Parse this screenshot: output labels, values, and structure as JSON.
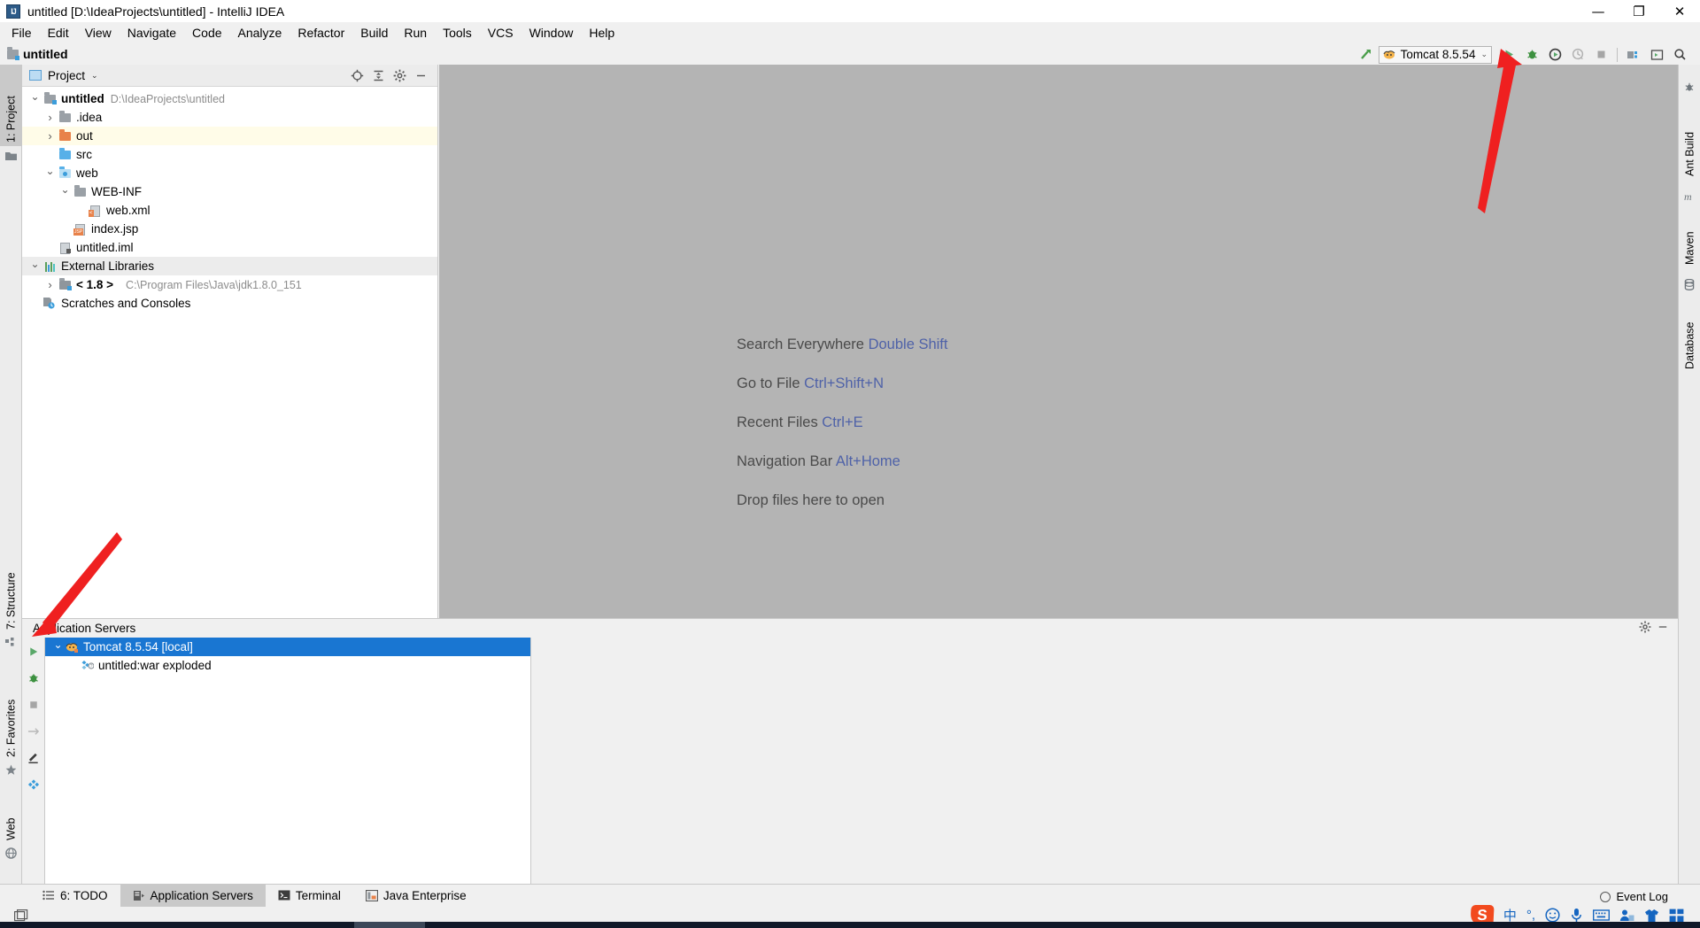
{
  "window": {
    "title": "untitled [D:\\IdeaProjects\\untitled] - IntelliJ IDEA",
    "logo": "IJ",
    "minimize": "—",
    "maximize": "❐",
    "close": "✕"
  },
  "menubar": {
    "items": [
      {
        "label": "File",
        "mnemonic": "F"
      },
      {
        "label": "Edit",
        "mnemonic": "E"
      },
      {
        "label": "View",
        "mnemonic": "V"
      },
      {
        "label": "Navigate",
        "mnemonic": "N"
      },
      {
        "label": "Code",
        "mnemonic": "C"
      },
      {
        "label": "Analyze",
        "mnemonic": "z"
      },
      {
        "label": "Refactor",
        "mnemonic": "R"
      },
      {
        "label": "Build",
        "mnemonic": "B"
      },
      {
        "label": "Run",
        "mnemonic": "n"
      },
      {
        "label": "Tools",
        "mnemonic": "T"
      },
      {
        "label": "VCS",
        "mnemonic": "S"
      },
      {
        "label": "Window",
        "mnemonic": "W"
      },
      {
        "label": "Help",
        "mnemonic": "H"
      }
    ]
  },
  "navbar": {
    "breadcrumb": "untitled"
  },
  "toolbar": {
    "build_hammer": "build-icon",
    "run_config": {
      "name": "Tomcat 8.5.54",
      "chevron": "⌄"
    },
    "buttons": [
      {
        "name": "run-button",
        "glyph": "▶"
      },
      {
        "name": "debug-button",
        "glyph": "bug"
      },
      {
        "name": "run-coverage-button",
        "glyph": "coverage"
      },
      {
        "name": "profile-button",
        "glyph": "profile"
      },
      {
        "name": "stop-button",
        "glyph": "■"
      },
      {
        "name": "project-structure-button",
        "glyph": "structure"
      },
      {
        "name": "hide-windows-button",
        "glyph": "window"
      },
      {
        "name": "search-everywhere-button",
        "glyph": "search"
      }
    ]
  },
  "left_strip": {
    "top": [
      {
        "label": "1: Project",
        "mnemonic": "1",
        "active": true,
        "icon": "project-icon"
      }
    ],
    "bottom": [
      {
        "label": "7: Structure",
        "mnemonic": "7",
        "icon": "structure-icon"
      },
      {
        "label": "2: Favorites",
        "mnemonic": "2",
        "icon": "star-icon"
      },
      {
        "label": "Web",
        "mnemonic": "",
        "icon": "globe-icon"
      }
    ]
  },
  "right_strip": {
    "items": [
      {
        "label": "Ant Build",
        "icon": "ant-icon"
      },
      {
        "label": "Maven",
        "icon": "maven-icon"
      },
      {
        "label": "Database",
        "icon": "database-icon"
      }
    ]
  },
  "project_panel": {
    "title": "Project",
    "chevron": "⌄",
    "actions": [
      {
        "name": "locate-file-button",
        "glyph": "⊕"
      },
      {
        "name": "collapse-all-button",
        "glyph": "⇱"
      },
      {
        "name": "settings-gear-button",
        "glyph": "⚙"
      },
      {
        "name": "hide-panel-button",
        "glyph": "—"
      }
    ],
    "tree": [
      {
        "label": "untitled",
        "path": "D:\\IdeaProjects\\untitled",
        "indent": 0,
        "twisty": "open",
        "icon": "module-folder",
        "bold": true,
        "highlight": "none"
      },
      {
        "label": ".idea",
        "path": "",
        "indent": 1,
        "twisty": "closed",
        "icon": "folder-grey",
        "bold": false,
        "highlight": "none"
      },
      {
        "label": "out",
        "path": "",
        "indent": 1,
        "twisty": "closed",
        "icon": "folder-orange",
        "bold": false,
        "highlight": "out"
      },
      {
        "label": "src",
        "path": "",
        "indent": 1,
        "twisty": "none",
        "icon": "folder-blue",
        "bold": false,
        "highlight": "none"
      },
      {
        "label": "web",
        "path": "",
        "indent": 1,
        "twisty": "open",
        "icon": "folder-web",
        "bold": false,
        "highlight": "none"
      },
      {
        "label": "WEB-INF",
        "path": "",
        "indent": 2,
        "twisty": "open",
        "icon": "folder-grey",
        "bold": false,
        "highlight": "none"
      },
      {
        "label": "web.xml",
        "path": "",
        "indent": 3,
        "twisty": "none",
        "icon": "file-xml",
        "bold": false,
        "highlight": "none"
      },
      {
        "label": "index.jsp",
        "path": "",
        "indent": 2,
        "twisty": "none",
        "icon": "file-jsp",
        "bold": false,
        "highlight": "none"
      },
      {
        "label": "untitled.iml",
        "path": "",
        "indent": 1,
        "twisty": "none",
        "icon": "file-iml",
        "bold": false,
        "highlight": "none"
      },
      {
        "label": "External Libraries",
        "path": "",
        "indent": 0,
        "twisty": "open",
        "icon": "library",
        "bold": false,
        "highlight": "selected"
      },
      {
        "label": "< 1.8 >",
        "path": "C:\\Program Files\\Java\\jdk1.8.0_151",
        "indent": 1,
        "twisty": "closed",
        "icon": "jdk",
        "bold": true,
        "highlight": "none"
      },
      {
        "label": "Scratches and Consoles",
        "path": "",
        "indent": 0,
        "twisty": "none",
        "icon": "scratches",
        "bold": false,
        "highlight": "none"
      }
    ]
  },
  "editor": {
    "hints": [
      {
        "action": "Search Everywhere",
        "shortcut": "Double Shift"
      },
      {
        "action": "Go to File",
        "shortcut": "Ctrl+Shift+N"
      },
      {
        "action": "Recent Files",
        "shortcut": "Ctrl+E"
      },
      {
        "action": "Navigation Bar",
        "shortcut": "Alt+Home"
      },
      {
        "action": "Drop files here to open",
        "shortcut": ""
      }
    ]
  },
  "app_servers": {
    "title": "Application Servers",
    "actions": [
      {
        "name": "settings-gear-button",
        "glyph": "⚙"
      },
      {
        "name": "hide-panel-button",
        "glyph": "—"
      }
    ],
    "toolbar": [
      {
        "name": "run-button",
        "glyph": "▶"
      },
      {
        "name": "debug-button",
        "glyph": "bug"
      },
      {
        "name": "stop-button",
        "glyph": "■"
      },
      {
        "name": "deploy-button",
        "glyph": "deploy"
      },
      {
        "name": "edit-configuration-button",
        "glyph": "pencil"
      },
      {
        "name": "artifacts-button",
        "glyph": "artifact"
      }
    ],
    "tree": [
      {
        "label": "Tomcat 8.5.54 [local]",
        "indent": 0,
        "twisty": "open",
        "icon": "tomcat-icon",
        "selected": true
      },
      {
        "label": "untitled:war exploded",
        "indent": 1,
        "twisty": "none",
        "icon": "artifact-icon",
        "selected": false
      }
    ]
  },
  "bottom_tabs": [
    {
      "label": "6: TODO",
      "mnemonic": "6",
      "icon": "todo-icon",
      "active": false
    },
    {
      "label": "Application Servers",
      "mnemonic": "",
      "icon": "server-icon",
      "active": true
    },
    {
      "label": "Terminal",
      "mnemonic": "",
      "icon": "terminal-icon",
      "active": false
    },
    {
      "label": "Java Enterprise",
      "mnemonic": "",
      "icon": "jee-icon",
      "active": false
    }
  ],
  "status_bar": {
    "event_log": "Event Log",
    "left_icon": "layout-icon"
  },
  "ime": {
    "logo": "S",
    "items": [
      "中",
      "°,",
      "☺",
      "🎤",
      "⌨",
      "👤",
      "👕",
      "▦"
    ]
  }
}
